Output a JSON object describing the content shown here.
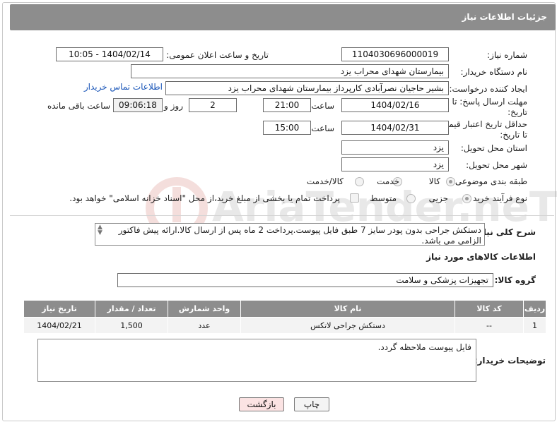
{
  "header": {
    "title": "جزئیات اطلاعات نیاز"
  },
  "fields": {
    "need_number_label": "شماره نیاز:",
    "need_number": "1104030696000019",
    "announce_label": "تاریخ و ساعت اعلان عمومی:",
    "announce_value": "1404/02/14 - 10:05",
    "buyer_org_label": "نام دستگاه خریدار:",
    "buyer_org": "بیمارستان شهدای محراب یزد",
    "creator_label": "ایجاد کننده درخواست:",
    "creator": "بشیر حاجیان نصرآبادی کارپرداز بیمارستان شهدای محراب یزد",
    "contact_link": "اطلاعات تماس خریدار",
    "reply_deadline_label": "مهلت ارسال پاسخ: تا تاریخ:",
    "reply_date": "1404/02/16",
    "time_label": "ساعت",
    "reply_time": "21:00",
    "days_value": "2",
    "days_label": "روز و",
    "remaining_time": "09:06:18",
    "remaining_label": "ساعت باقی مانده",
    "price_deadline_label": "حداقل تاریخ اعتبار قیمت: تا تاریخ:",
    "price_date": "1404/02/31",
    "price_time": "15:00",
    "province_label": "استان محل تحویل:",
    "province": "یزد",
    "city_label": "شهر محل تحویل:",
    "city": "یزد",
    "category_label": "طبقه بندی موضوعی:",
    "category_options": [
      "کالا",
      "خدمت",
      "کالا/خدمت"
    ],
    "process_label": "نوع فرآیند خرید :",
    "process_options": [
      "جزیی",
      "متوسط"
    ],
    "payment_note": "پرداخت تمام یا بخشی از مبلغ خرید،از محل \"اسناد خزانه اسلامی\" خواهد بود."
  },
  "description": {
    "label": "شرح کلی نیاز:",
    "text": "دستکش جراحی بدون پودر سایز 7 طبق فایل پیوست.پرداخت 2 ماه پس از ارسال کالا.ارائه پیش فاکتور الزامی می باشد."
  },
  "goods": {
    "section_title": "اطلاعات کالاهای مورد نیاز",
    "group_label": "گروه کالا:",
    "group_value": "تجهیزات پزشکی و سلامت",
    "columns": [
      "ردیف",
      "کد کالا",
      "نام کالا",
      "واحد شمارش",
      "تعداد / مقدار",
      "تاریخ نیاز"
    ],
    "rows": [
      [
        "1",
        "--",
        "دستکش جراحی لاتکس",
        "عدد",
        "1,500",
        "1404/02/21"
      ]
    ]
  },
  "buyer_notes": {
    "label": "توضیحات خریدار:",
    "text": "فایل پیوست ملاحظه گردد."
  },
  "buttons": {
    "print": "چاپ",
    "back": "بازگشت"
  },
  "colors": {
    "header_bg": "#8d8d8d",
    "link": "#1a56b8",
    "back_button_bg": "#fbe3e3"
  }
}
